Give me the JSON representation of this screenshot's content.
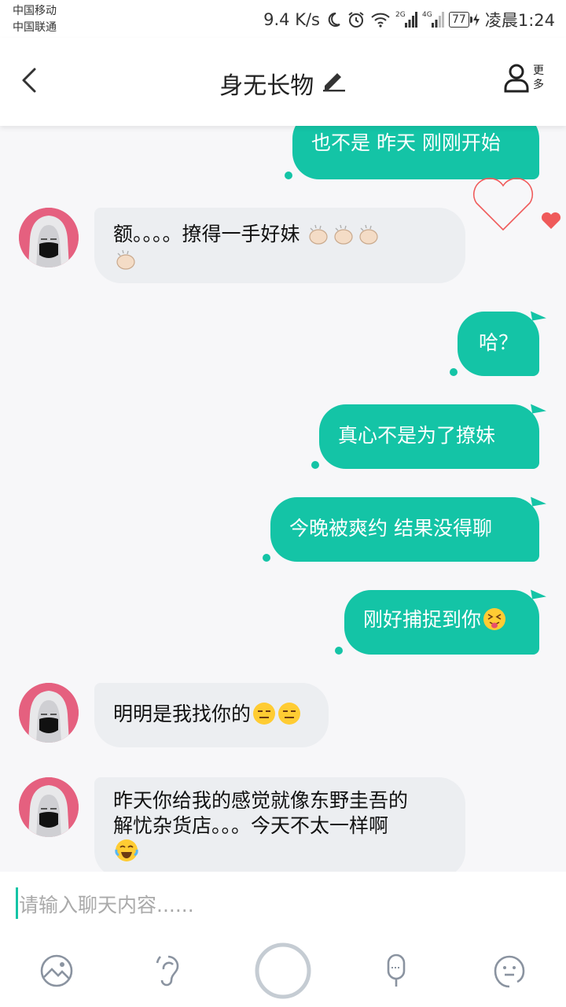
{
  "status_bar": {
    "carrier_1": "中国移动",
    "carrier_2": "中国联通",
    "speed": "9.4 K/s",
    "net_1": "2G",
    "net_2": "4G",
    "battery": "77",
    "time": "凌晨1:24"
  },
  "header": {
    "title": "身无长物",
    "more_label": "更多",
    "icons": [
      "back-arrow-icon",
      "edit-pencil-icon",
      "user-icon"
    ]
  },
  "messages": [
    {
      "side": "out",
      "text": "也不是 昨天 刚刚开始"
    },
    {
      "side": "in",
      "text": "额。。。。撩得一手好妹",
      "emoji": "clapping-hands x4"
    },
    {
      "side": "out",
      "text": "哈？"
    },
    {
      "side": "out",
      "text": "真心不是为了撩妹"
    },
    {
      "side": "out",
      "text": "今晚被爽约 结果没得聊"
    },
    {
      "side": "out",
      "text": "刚好捕捉到你",
      "emoji": "squinting-tongue-face"
    },
    {
      "side": "in",
      "text": "明明是我找你的",
      "emoji": "expressionless-face x2"
    },
    {
      "side": "in",
      "line_1": "昨天你给我的感觉就像东野圭吾的",
      "line_2": "解忧杂货店。。。今天不太一样啊",
      "emoji": "tears-of-joy-face"
    }
  ],
  "input": {
    "placeholder": "请输入聊天内容......"
  },
  "toolbar": {
    "icons": [
      "image-icon",
      "voice-icon",
      "record-circle-icon",
      "mic-icon",
      "emoji-face-icon"
    ]
  },
  "colors": {
    "accent": "#14c4a6",
    "incoming_bubble": "#eceef1",
    "heart": "#ef5a5a"
  }
}
